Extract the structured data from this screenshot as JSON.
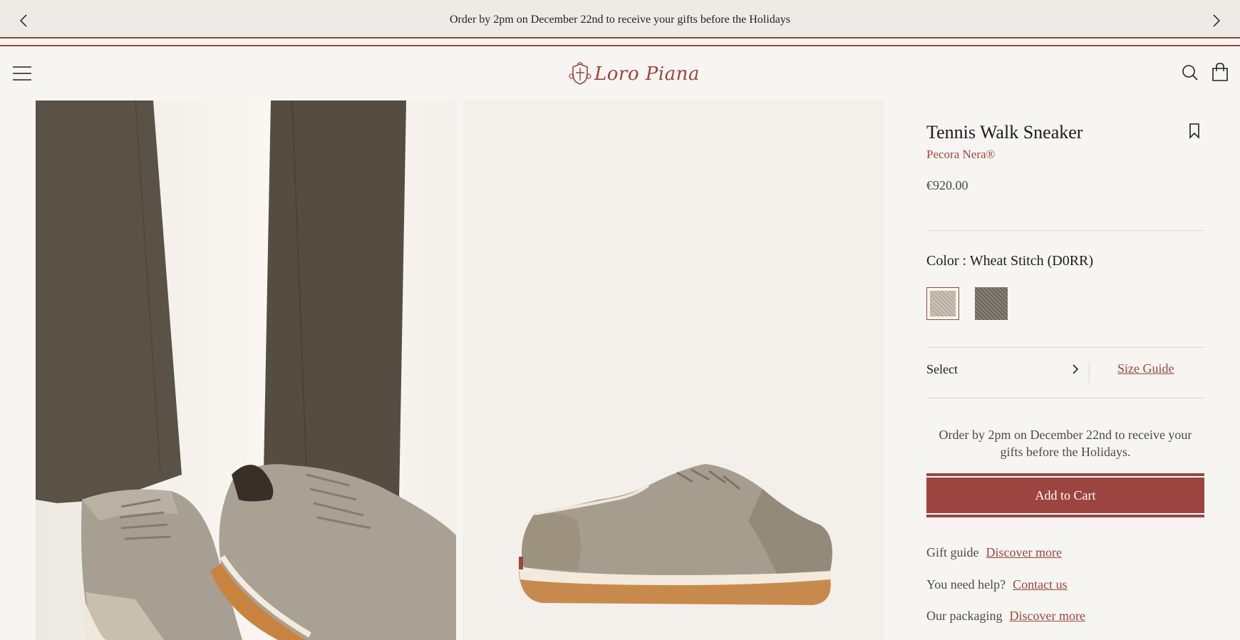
{
  "announcement": {
    "text": "Order by 2pm on December 22nd to receive your gifts before the Holidays",
    "prev_icon": "chevron-left-icon",
    "next_icon": "chevron-right-icon"
  },
  "header": {
    "logo_text": "Loro Piana",
    "menu_icon": "hamburger-icon",
    "search_icon": "search-icon",
    "bag_icon": "shopping-bag-icon"
  },
  "product": {
    "title": "Tennis Walk Sneaker",
    "material": "Pecora Nera®",
    "price": "€920.00",
    "color_label": "Color : Wheat Stitch (D0RR)",
    "swatches": [
      {
        "name": "Wheat Stitch",
        "color": "#c2b8a9",
        "selected": true
      },
      {
        "name": "Dark",
        "color": "#7a7268",
        "selected": false
      }
    ],
    "size_select_label": "Select",
    "size_guide_label": "Size Guide",
    "delivery_note": "Order by 2pm on December 22nd to receive your gifts before the Holidays.",
    "add_to_cart_label": "Add to Cart",
    "info_links": [
      {
        "label": "Gift guide",
        "link": "Discover more"
      },
      {
        "label": "You need help?",
        "link": "Contact us"
      },
      {
        "label": "Our packaging",
        "link": "Discover more"
      }
    ]
  },
  "colors": {
    "accent": "#9c4540",
    "background": "#f7f5f1",
    "announcement_bg": "#eeebe6"
  }
}
